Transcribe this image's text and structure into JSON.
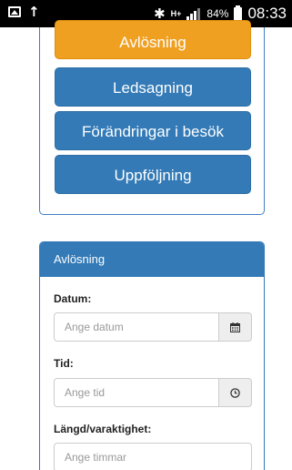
{
  "status_bar": {
    "network": "H+",
    "battery": "84%",
    "time": "08:33"
  },
  "menu": {
    "buttons": [
      {
        "label": "Avlösning",
        "color": "#f0a021"
      },
      {
        "label": "Ledsagning",
        "color": "#337ab7"
      },
      {
        "label": "Förändringar i besök",
        "color": "#337ab7"
      },
      {
        "label": "Uppföljning",
        "color": "#337ab7"
      }
    ]
  },
  "form": {
    "heading": "Avlösning",
    "date": {
      "label": "Datum:",
      "placeholder": "Ange datum",
      "icon": "calendar-icon"
    },
    "time": {
      "label": "Tid:",
      "placeholder": "Ange tid",
      "icon": "clock-icon"
    },
    "duration": {
      "label": "Längd/varaktighet:",
      "placeholder": "Ange timmar"
    }
  },
  "colors": {
    "primary": "#337ab7",
    "warning": "#f0a021"
  }
}
